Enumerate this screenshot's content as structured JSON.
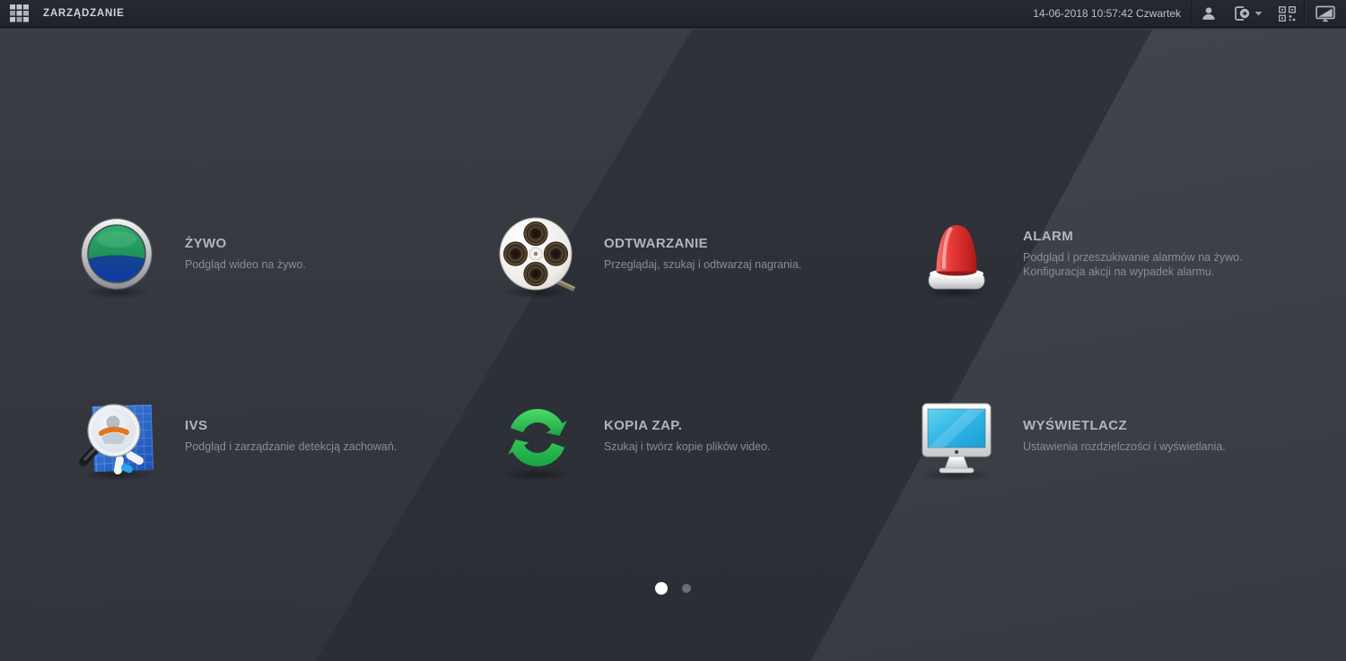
{
  "topbar": {
    "app_title": "ZARZĄDZANIE",
    "datetime": "14-06-2018 10:57:42 Czwartek",
    "icons": [
      "apps-grid-icon",
      "user-icon",
      "logout-icon",
      "chevron-down-icon",
      "qr-code-icon",
      "screen-adapter-icon"
    ]
  },
  "menu": {
    "items": [
      {
        "title": "ŻYWO",
        "desc": "Podgląd wideo na żywo.",
        "icon": "live-lens-icon"
      },
      {
        "title": "ODTWARZANIE",
        "desc": "Przeglądaj, szukaj i odtwarzaj nagrania.",
        "icon": "film-reel-icon"
      },
      {
        "title": "ALARM",
        "desc": "Podgląd i przeszukiwanie alarmów na żywo.",
        "desc2": "Konfiguracja akcji na wypadek alarmu.",
        "icon": "alarm-siren-icon"
      },
      {
        "title": "IVS",
        "desc": "Podgląd i zarządzanie detekcją zachowań.",
        "icon": "ivs-magnifier-icon"
      },
      {
        "title": "KOPIA ZAP.",
        "desc": "Szukaj i twórz kopie plików video.",
        "icon": "backup-sync-icon"
      },
      {
        "title": "WYŚWIETLACZ",
        "desc": "Ustawienia rozdzielczości i wyświetlania.",
        "icon": "display-monitor-icon"
      }
    ]
  },
  "pagination": {
    "total_pages": 2,
    "active_page": 1
  },
  "colors": {
    "topbar_bg": "#1f222a",
    "content_bg": "#34373e",
    "dark_band": "#2e3138",
    "right_panel": "#44474e",
    "title_text": "#b2b6bc",
    "desc_text": "#898d94",
    "active_dot": "#ffffff",
    "inactive_dot": "#6b6e74",
    "accent_green": "#2bb45a",
    "accent_red": "#d92b2b",
    "accent_blue": "#2f6fd8",
    "accent_cyan": "#2fb4e4"
  }
}
